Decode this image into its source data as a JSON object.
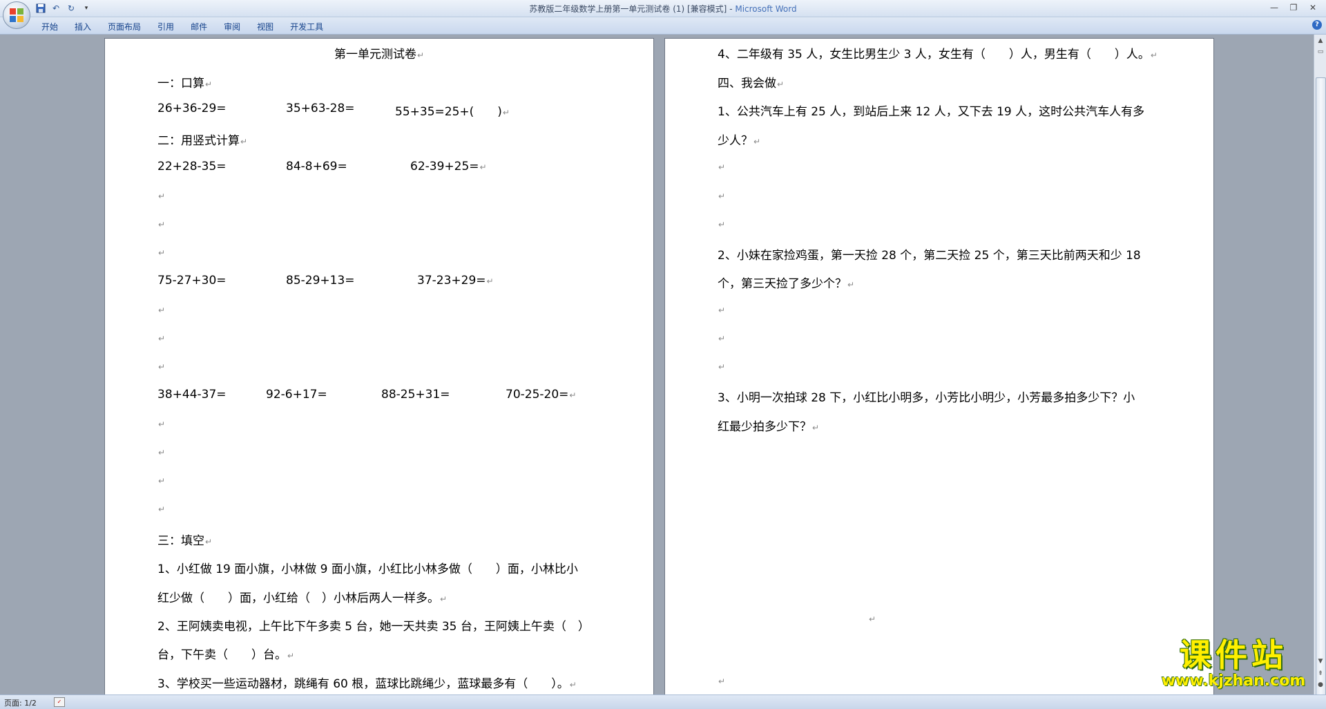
{
  "window": {
    "title_doc": "苏教版二年级数学上册第一单元测试卷 (1) [兼容模式]",
    "title_sep": " - ",
    "title_app": "Microsoft Word"
  },
  "ribbon": {
    "tabs": [
      "开始",
      "插入",
      "页面布局",
      "引用",
      "邮件",
      "审阅",
      "视图",
      "开发工具"
    ]
  },
  "page1": {
    "heading": "第一单元测试卷",
    "s1_title": "一：口算",
    "s1_items": [
      "26+36-29=",
      "35+63-28=",
      "55+35=25+(　　)"
    ],
    "s2_title": "二：用竖式计算",
    "s2_row1": [
      "22+28-35=",
      "84-8+69=",
      "62-39+25="
    ],
    "s2_row2": [
      "75-27+30=",
      "85-29+13=",
      "37-23+29="
    ],
    "s2_row3": [
      "38+44-37=",
      "92-6+17=",
      "88-25+31=",
      "70-25-20="
    ],
    "s3_title": "三：填空",
    "s3_q1_a": "1、小红做 19 面小旗，小林做 9 面小旗，小红比小林多做（　　）面，小林比小",
    "s3_q1_b": "红少做（　　）面，小红给（　）小林后两人一样多。",
    "s3_q2_a": "2、王阿姨卖电视，上午比下午多卖 5 台，她一天共卖 35 台，王阿姨上午卖（　）",
    "s3_q2_b": "台，下午卖（　　）台。",
    "s3_q3_a": "3、学校买一些运动器材，跳绳有 60 根，蓝球比跳绳少，蓝球最多有（　　）。"
  },
  "page2": {
    "q4": "4、二年级有 35 人，女生比男生少 3 人，女生有（　　）人，男生有（　　）人。",
    "s4_title": "四、我会做",
    "p1_a": "1、公共汽车上有 25 人，到站后上来 12 人，又下去 19 人，这时公共汽车人有多",
    "p1_b": "少人？",
    "p2_a": "2、小妹在家捡鸡蛋，第一天捡 28 个，第二天捡 25 个，第三天比前两天和少 18",
    "p2_b": "个，第三天捡了多少个？",
    "p3_a": "3、小明一次拍球 28 下，小红比小明多，小芳比小明少，小芳最多拍多少下？小",
    "p3_b": "红最少拍多少下？"
  },
  "paragraph_mark": "↵",
  "status": {
    "page": "页面: 1/2"
  },
  "watermark": {
    "big": "课件站",
    "small": "www.kjzhan.com"
  }
}
